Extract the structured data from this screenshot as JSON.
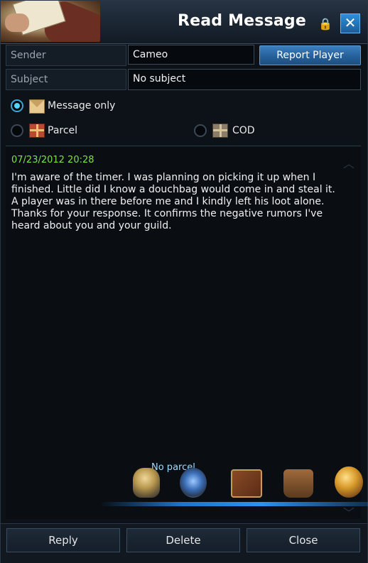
{
  "window": {
    "title": "Read Message",
    "close_glyph": "✕",
    "lock_glyph": "🔒"
  },
  "sender": {
    "label": "Sender",
    "value": "Cameo",
    "report_label": "Report Player"
  },
  "subject": {
    "label": "Subject",
    "value": "No subject"
  },
  "options": {
    "message_only": {
      "label": "Message only",
      "checked": true,
      "icon": "envelope-icon"
    },
    "parcel": {
      "label": "Parcel",
      "checked": false,
      "icon": "parcel-gift-icon"
    },
    "cod": {
      "label": "COD",
      "checked": false,
      "icon": "cod-gift-icon"
    }
  },
  "message": {
    "timestamp": "07/23/2012 20:28",
    "body": "I'm aware of the timer.  I was planning on picking it up when I finished.  Little did I know a douchbag would come in and steal it. A player was in there before me and I kindly left his loot alone. Thanks for your response.  It confirms the negative rumors I've heard about you and your guild."
  },
  "parcel_area": {
    "no_parcel_text": "No parcel",
    "items": [
      "helmet-icon",
      "shield-icon",
      "book-icon",
      "bag-icon",
      "globe-icon"
    ]
  },
  "footer": {
    "reply_label": "Reply",
    "delete_label": "Delete",
    "close_label": "Close"
  },
  "colors": {
    "accent_blue": "#2f8fd6",
    "timestamp_green": "#7ee04a",
    "background": "#0d1218"
  }
}
